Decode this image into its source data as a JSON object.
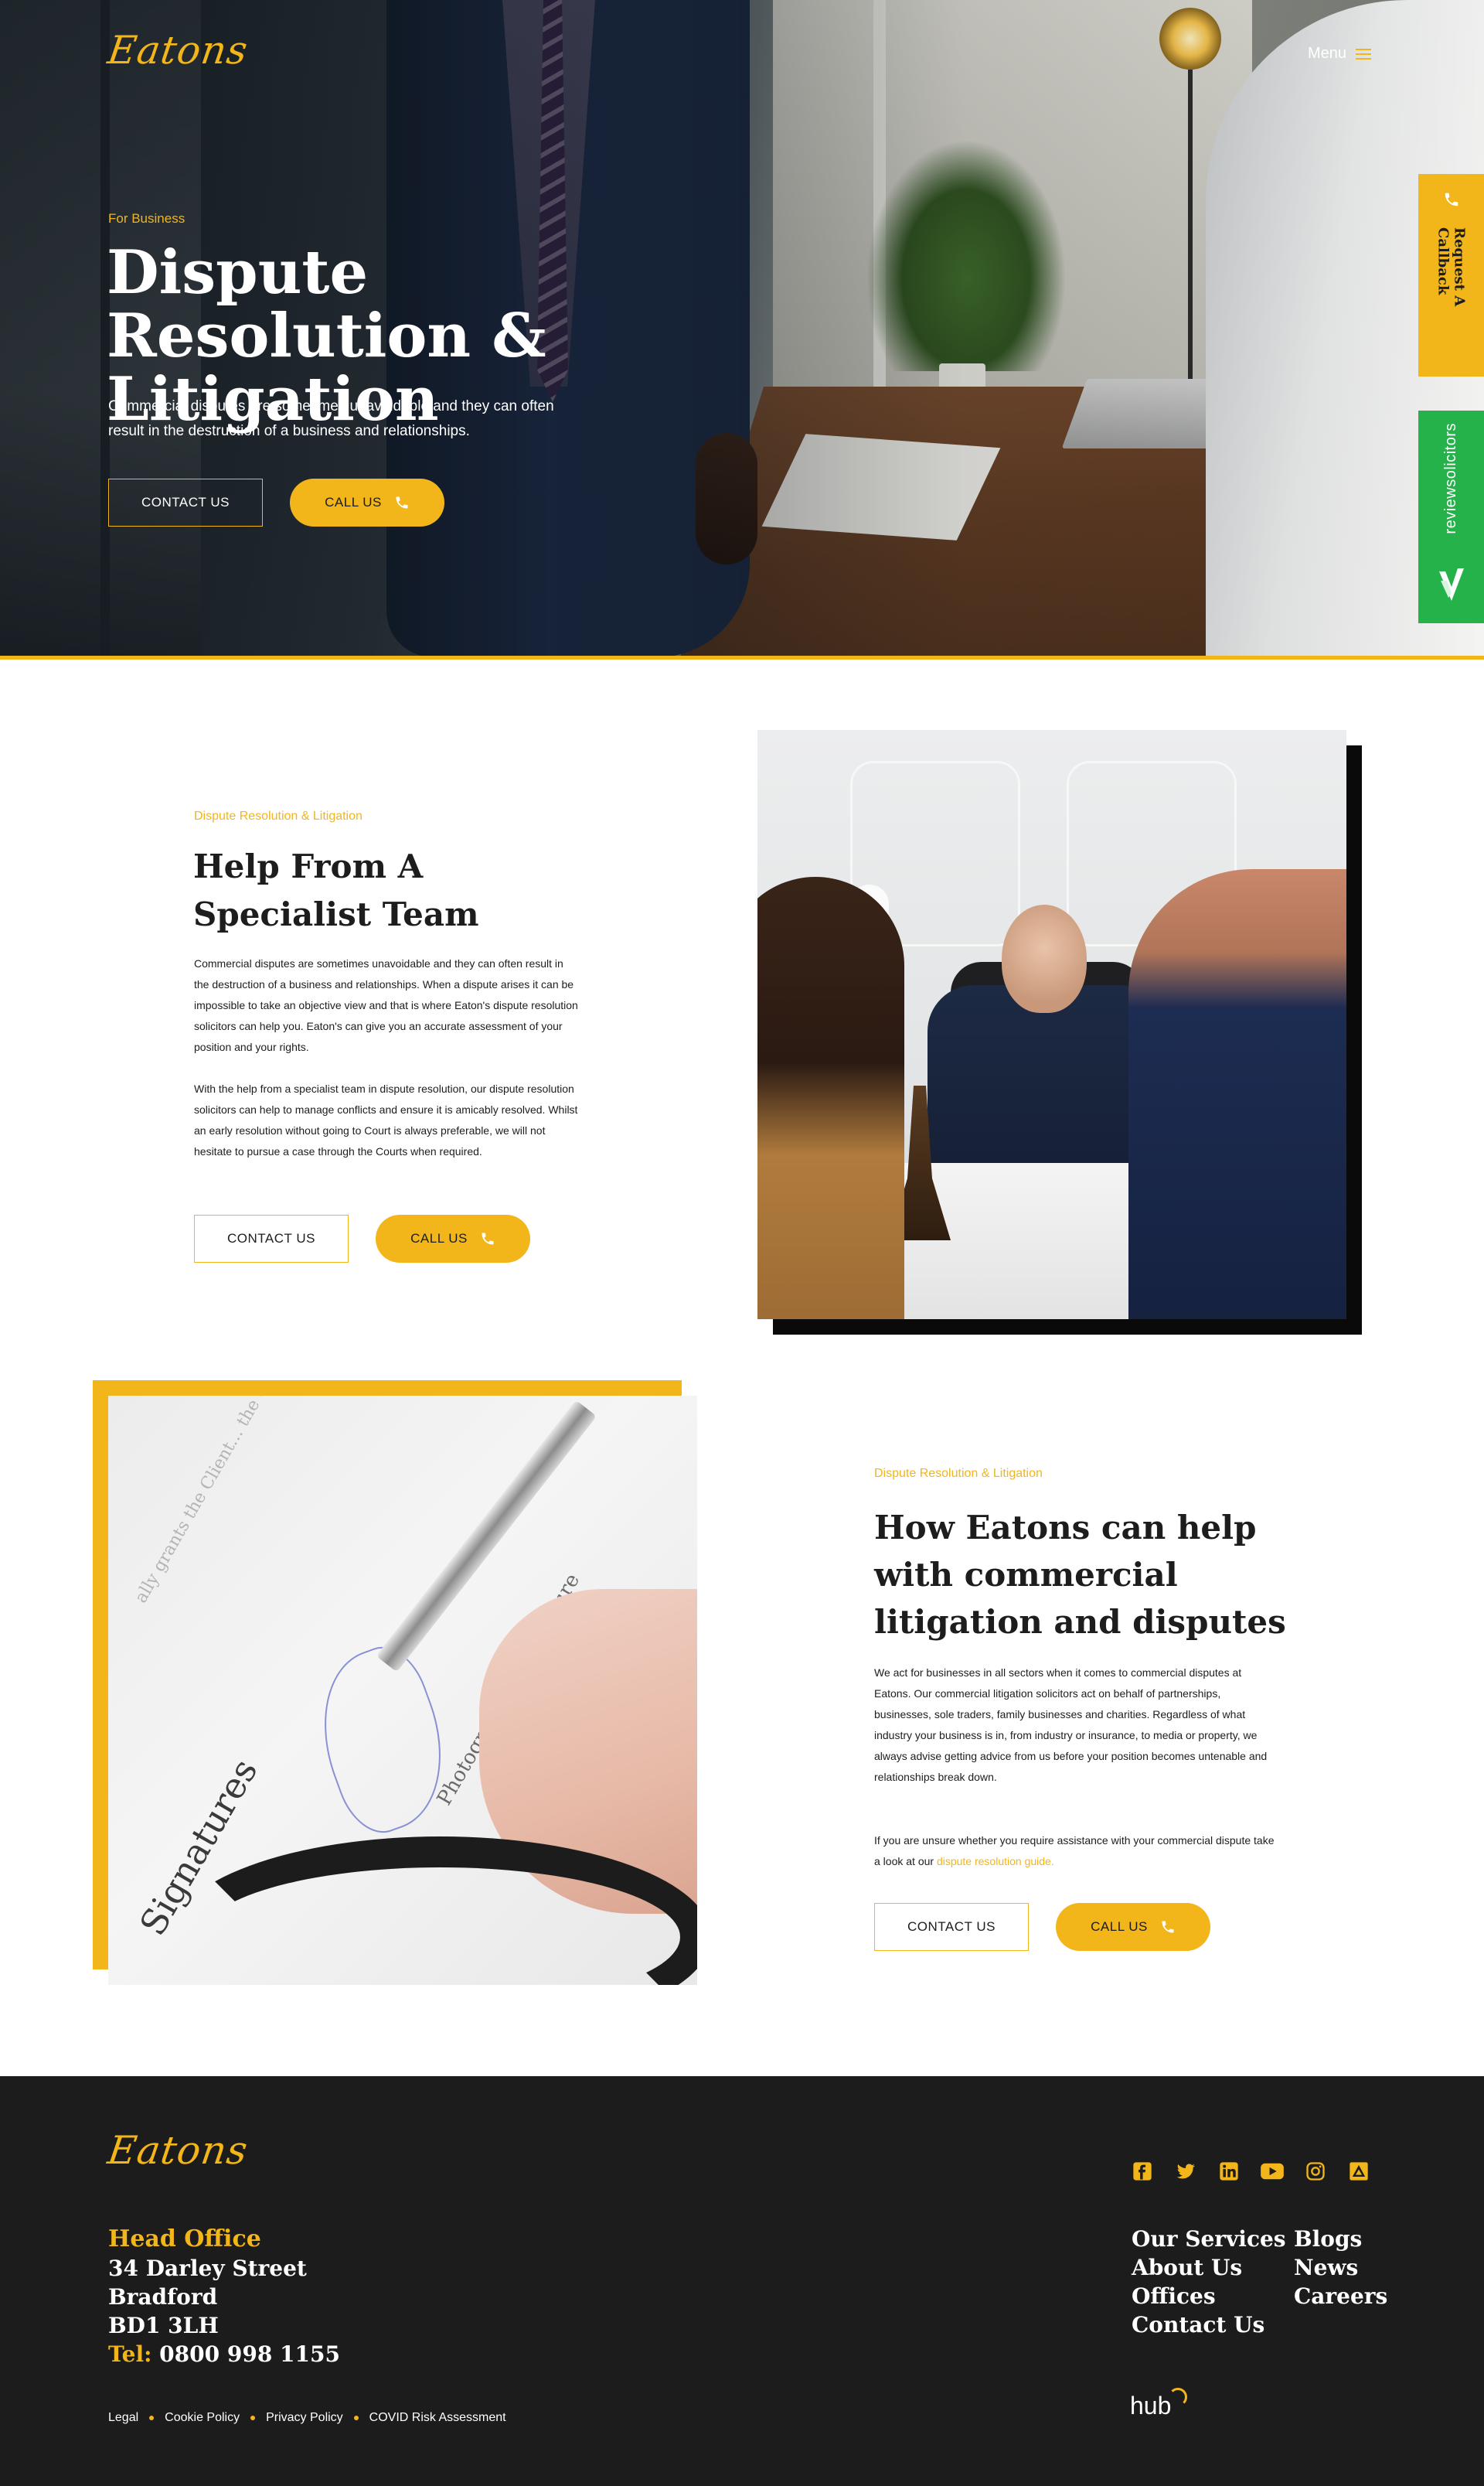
{
  "brand": {
    "logo_text": "Eatons",
    "accent_color": "#f2b51a",
    "green_color": "#25b24b",
    "dark_color": "#1c1c1c"
  },
  "header": {
    "menu_label": "Menu",
    "menu_icon": "hamburger-icon"
  },
  "hero": {
    "eyebrow": "For Business",
    "title": "Dispute Resolution & Litigation",
    "text": "Commercial disputes are sometimes unavoidable and they can often result in the destruction of a business and relationships.",
    "contact_label": "CONTACT US",
    "call_label": "CALL US"
  },
  "side_tabs": {
    "callback_label": "Request A Callback",
    "callback_icon": "phone-icon",
    "reviews_label": "reviewsolicitors",
    "reviews_icon": "reviewsolicitors-logo-icon"
  },
  "section1": {
    "eyebrow": "Dispute Resolution & Litigation",
    "title": "Help From A Specialist Team",
    "paragraph1": "Commercial disputes are sometimes unavoidable and they can often result in the destruction of a business and relationships. When a dispute arises it can be impossible to take an objective view and that is where Eaton's dispute resolution solicitors can help you. Eaton's can give you an accurate assessment of your position and your rights.",
    "paragraph2": "With the help from a specialist team in dispute resolution, our dispute resolution solicitors can help to manage conflicts and ensure it is amicably resolved. Whilst an early resolution without going to Court is always preferable, we will not hesitate to pursue a case through the Courts when required.",
    "contact_label": "CONTACT US",
    "call_label": "CALL US"
  },
  "section2": {
    "eyebrow": "Dispute Resolution & Litigation",
    "title": "How Eatons can help with commercial litigation and disputes",
    "paragraph1": "We act for businesses in all sectors when it comes to commercial disputes at Eatons. Our commercial litigation solicitors act on behalf of partnerships, businesses, sole traders, family businesses and charities. Regardless of what industry your business is in, from industry or insurance, to media or property, we always advise getting advice from us before your position becomes untenable and relationships break down.",
    "paragraph2_prefix": "If you are unsure whether you require assistance with your commercial dispute take a look at our ",
    "paragraph2_link": "dispute resolution guide.",
    "contact_label": "CONTACT US",
    "call_label": "CALL US",
    "image_text_big": "Signatures",
    "image_text_small": "Photographer's Signature",
    "image_text_faint": "ally grants the Client... the Client pays."
  },
  "footer": {
    "head_office_label": "Head Office",
    "address_line1": "34 Darley Street",
    "address_line2": "Bradford",
    "address_line3": "BD1 3LH",
    "tel_label": "Tel:",
    "tel_number": "0800 998 1155",
    "social_icons": [
      "facebook-icon",
      "twitter-icon",
      "linkedin-icon",
      "youtube-icon",
      "instagram-icon",
      "legal500-icon"
    ],
    "nav_col1": [
      "Our Services",
      "About Us",
      "Offices",
      "Contact Us"
    ],
    "nav_col2": [
      "Blogs",
      "News",
      "Careers"
    ],
    "legal_links": [
      "Legal",
      "Cookie Policy",
      "Privacy Policy",
      "COVID Risk Assessment"
    ],
    "hub_label": "hub"
  }
}
